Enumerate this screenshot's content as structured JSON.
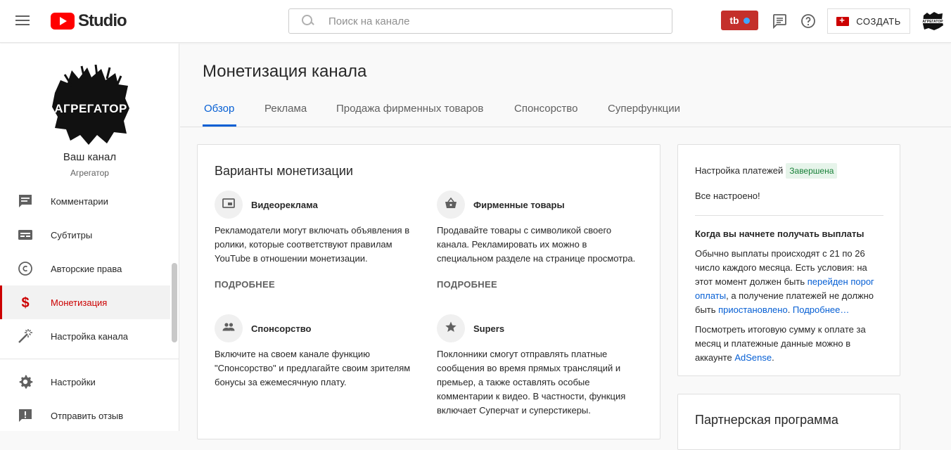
{
  "header": {
    "logo_text": "Studio",
    "search_placeholder": "Поиск на канале",
    "tb_label": "tb",
    "create_label": "СОЗДАТЬ",
    "brand_color": "#ff0000"
  },
  "sidebar": {
    "channel_logo_text": "АГРЕГАТОР",
    "channel_title": "Ваш канал",
    "channel_name": "Агрегатор",
    "items": [
      {
        "label": "Комментарии",
        "icon": "comment-icon"
      },
      {
        "label": "Субтитры",
        "icon": "subtitles-icon"
      },
      {
        "label": "Авторские права",
        "icon": "copyright-icon"
      },
      {
        "label": "Монетизация",
        "icon": "dollar-icon",
        "active": true
      },
      {
        "label": "Настройка канала",
        "icon": "magic-wand-icon"
      },
      {
        "label": "Настройки",
        "icon": "gear-icon"
      },
      {
        "label": "Отправить отзыв",
        "icon": "feedback-icon"
      }
    ]
  },
  "main": {
    "title": "Монетизация канала",
    "tabs": [
      {
        "label": "Обзор",
        "active": true
      },
      {
        "label": "Реклама"
      },
      {
        "label": "Продажа фирменных товаров"
      },
      {
        "label": "Спонсорство"
      },
      {
        "label": "Суперфункции"
      }
    ],
    "options_card": {
      "title": "Варианты монетизации",
      "options": [
        {
          "title": "Видеореклама",
          "icon": "video-ad-icon",
          "desc": "Рекламодатели могут включать объявления в ролики, которые соответствуют правилам YouTube в отношении монетизации.",
          "more": "ПОДРОБНЕЕ"
        },
        {
          "title": "Фирменные товары",
          "icon": "shopping-basket-icon",
          "desc": "Продавайте товары с символикой своего канала. Рекламировать их можно в специальном разделе на странице просмотра.",
          "more": "ПОДРОБНЕЕ"
        },
        {
          "title": "Спонсорство",
          "icon": "people-icon",
          "desc": "Включите на своем канале функцию \"Спонсорство\" и предлагайте своим зрителям бонусы за ежемесячную плату."
        },
        {
          "title": "Supers",
          "icon": "star-icon",
          "desc": "Поклонники смогут отправлять платные сообщения во время прямых трансляций и премьер, а также оставлять особые комментарии к видео. В частности, функция включает Суперчат и суперстикеры."
        }
      ]
    },
    "payments_card": {
      "setup_label": "Настройка платежей",
      "setup_status": "Завершена",
      "setup_done": "Все настроено!",
      "payout_title": "Когда вы начнете получать выплаты",
      "payout_text_1": "Обычно выплаты происходят с 21 по 26 число каждого месяца. Есть условия: на этот момент должен быть ",
      "payout_link_1": "перейден порог оплаты",
      "payout_text_2": ", а получение платежей не должно быть ",
      "payout_link_2": "приостановлено",
      "payout_text_3": ". ",
      "payout_link_3": "Подробнее…",
      "summary_text": "Посмотреть итоговую сумму к оплате за месяц и платежные данные можно в аккаунте ",
      "summary_link": "AdSense",
      "summary_end": "."
    },
    "partner_card": {
      "title": "Партнерская программа"
    }
  }
}
